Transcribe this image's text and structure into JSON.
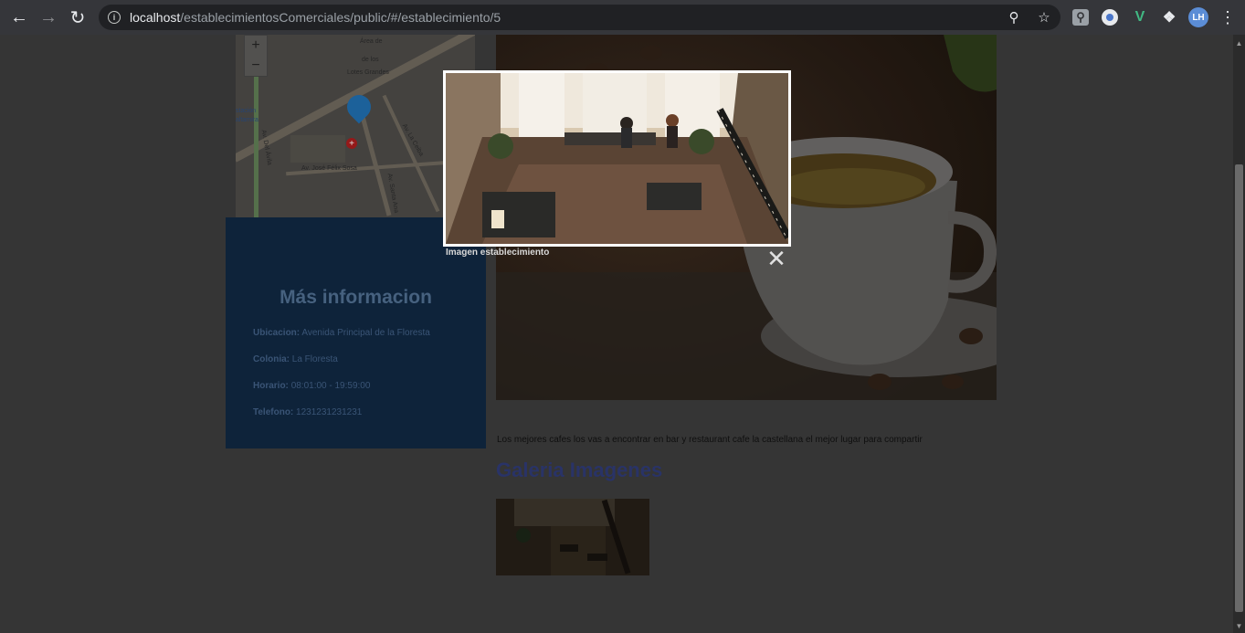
{
  "browser": {
    "url_host": "localhost",
    "url_path": "/establecimientosComerciales/public/#/establecimiento/5",
    "profile_initials": "LH",
    "icons": [
      "back-arrow-icon",
      "forward-arrow-icon",
      "reload-icon",
      "info-icon",
      "zoom-icon",
      "star-icon",
      "extension-search-icon",
      "extension-circle-icon",
      "vue-icon",
      "puzzle-icon",
      "menu-dots-icon"
    ]
  },
  "map": {
    "zoom_in": "+",
    "zoom_out": "−",
    "labels": [
      "Área de",
      "de los",
      "Lotes Grandes",
      "stación",
      "altamira",
      "Av. José Félix Sosa",
      "Av. Santa Ana",
      "Av. Del Ávila",
      "Av. La Ceiba"
    ]
  },
  "info": {
    "title": "Más informacion",
    "ubicacion_label": "Ubicacion:",
    "ubicacion_value": "Avenida Principal de la Floresta",
    "colonia_label": "Colonia:",
    "colonia_value": "La Floresta",
    "horario_label": "Horario:",
    "horario_value": "08:01:00 - 19:59:00",
    "telefono_label": "Telefono:",
    "telefono_value": "1231231231231"
  },
  "main": {
    "description": "Los mejores cafes los vas a encontrar en bar y restaurant cafe la castellana el mejor lugar para compartir",
    "gallery_title": "Galeria Imagenes"
  },
  "lightbox": {
    "caption": "Imagen establecimiento",
    "close": "✕"
  }
}
